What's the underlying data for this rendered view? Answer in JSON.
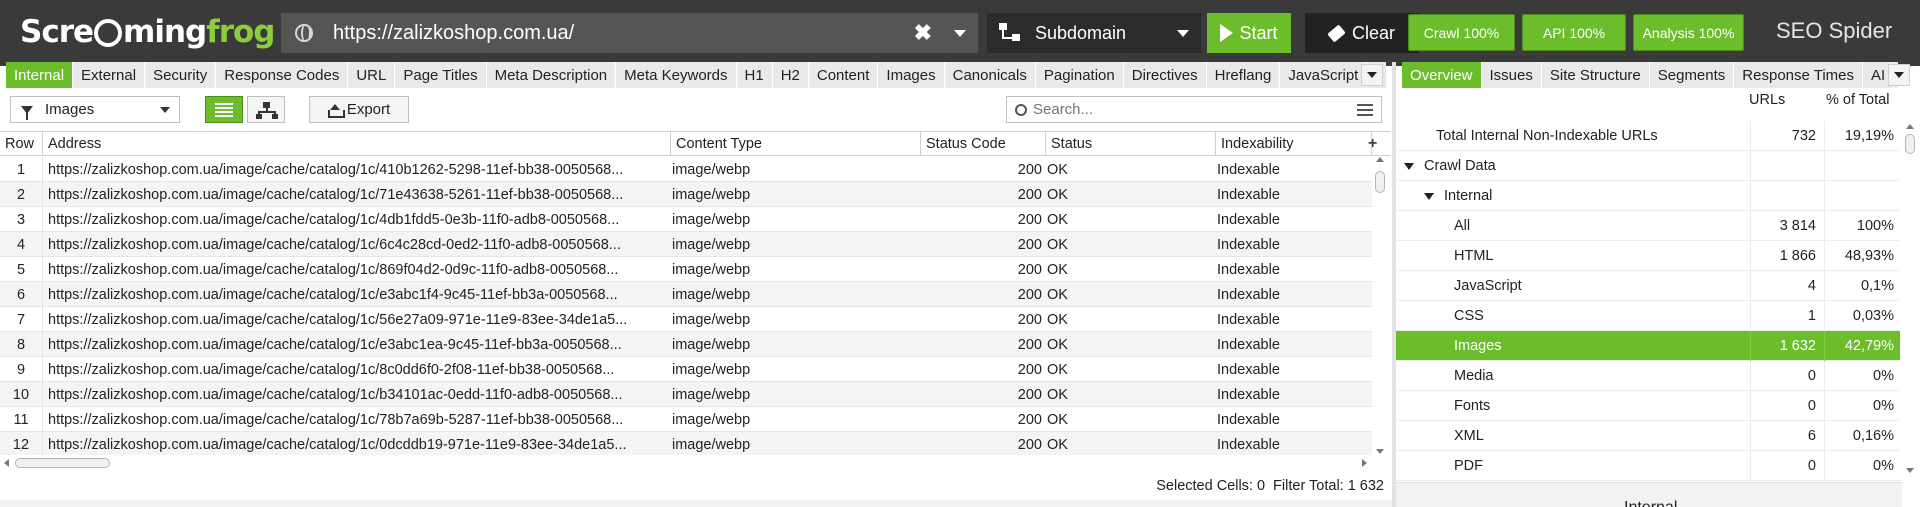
{
  "app": {
    "logo_part1": "Scre",
    "logo_part2": "ming",
    "logo_part3": "frog",
    "product": "SEO Spider"
  },
  "topbar": {
    "url": "https://zalizkoshop.com.ua/",
    "clear_glyph": "✖",
    "mode": "Subdomain",
    "start_label": "Start",
    "clear_label": "Clear",
    "crawl_progress": "Crawl 100%",
    "api_progress": "API 100%",
    "analysis_progress": "Analysis 100%"
  },
  "tabs_left": [
    {
      "label": "Internal",
      "active": true
    },
    {
      "label": "External"
    },
    {
      "label": "Security"
    },
    {
      "label": "Response Codes"
    },
    {
      "label": "URL"
    },
    {
      "label": "Page Titles"
    },
    {
      "label": "Meta Description"
    },
    {
      "label": "Meta Keywords"
    },
    {
      "label": "H1"
    },
    {
      "label": "H2"
    },
    {
      "label": "Content"
    },
    {
      "label": "Images"
    },
    {
      "label": "Canonicals"
    },
    {
      "label": "Pagination"
    },
    {
      "label": "Directives"
    },
    {
      "label": "Hreflang"
    },
    {
      "label": "JavaScript"
    }
  ],
  "tabs_right": [
    {
      "label": "Overview",
      "active": true
    },
    {
      "label": "Issues"
    },
    {
      "label": "Site Structure"
    },
    {
      "label": "Segments"
    },
    {
      "label": "Response Times"
    },
    {
      "label": "AI"
    }
  ],
  "toolbar": {
    "filter_value": "Images",
    "export_label": "Export",
    "search_placeholder": "Search..."
  },
  "table": {
    "columns": [
      "Row",
      "Address",
      "Content Type",
      "Status Code",
      "Status",
      "Indexability"
    ],
    "rows": [
      [
        "1",
        "https://zalizkoshop.com.ua/image/cache/catalog/1c/410b1262-5298-11ef-bb38-0050568...",
        "image/webp",
        "200",
        "OK",
        "Indexable"
      ],
      [
        "2",
        "https://zalizkoshop.com.ua/image/cache/catalog/1c/71e43638-5261-11ef-bb38-0050568...",
        "image/webp",
        "200",
        "OK",
        "Indexable"
      ],
      [
        "3",
        "https://zalizkoshop.com.ua/image/cache/catalog/1c/4db1fdd5-0e3b-11f0-adb8-0050568...",
        "image/webp",
        "200",
        "OK",
        "Indexable"
      ],
      [
        "4",
        "https://zalizkoshop.com.ua/image/cache/catalog/1c/6c4c28cd-0ed2-11f0-adb8-0050568...",
        "image/webp",
        "200",
        "OK",
        "Indexable"
      ],
      [
        "5",
        "https://zalizkoshop.com.ua/image/cache/catalog/1c/869f04d2-0d9c-11f0-adb8-0050568...",
        "image/webp",
        "200",
        "OK",
        "Indexable"
      ],
      [
        "6",
        "https://zalizkoshop.com.ua/image/cache/catalog/1c/e3abc1f4-9c45-11ef-bb3a-0050568...",
        "image/webp",
        "200",
        "OK",
        "Indexable"
      ],
      [
        "7",
        "https://zalizkoshop.com.ua/image/cache/catalog/1c/56e27a09-971e-11e9-83ee-34de1a5...",
        "image/webp",
        "200",
        "OK",
        "Indexable"
      ],
      [
        "8",
        "https://zalizkoshop.com.ua/image/cache/catalog/1c/e3abc1ea-9c45-11ef-bb3a-0050568...",
        "image/webp",
        "200",
        "OK",
        "Indexable"
      ],
      [
        "9",
        "https://zalizkoshop.com.ua/image/cache/catalog/1c/8c0dd6f0-2f08-11ef-bb38-0050568...",
        "image/webp",
        "200",
        "OK",
        "Indexable"
      ],
      [
        "10",
        "https://zalizkoshop.com.ua/image/cache/catalog/1c/b34101ac-0edd-11f0-adb8-0050568...",
        "image/webp",
        "200",
        "OK",
        "Indexable"
      ],
      [
        "11",
        "https://zalizkoshop.com.ua/image/cache/catalog/1c/78b7a69b-5287-11ef-bb38-0050568...",
        "image/webp",
        "200",
        "OK",
        "Indexable"
      ],
      [
        "12",
        "https://zalizkoshop.com.ua/image/cache/catalog/1c/0dcddb19-971e-11e9-83ee-34de1a5...",
        "image/webp",
        "200",
        "OK",
        "Indexable"
      ]
    ]
  },
  "status_bar": {
    "selected_label": "Selected Cells:",
    "selected_value": "0",
    "filter_label": "Filter Total:",
    "filter_value": "1 632"
  },
  "overview": {
    "col_urls": "URLs",
    "col_pct": "% of Total",
    "rows": [
      {
        "label": "Total Internal Non-Indexable URLs",
        "urls": "732",
        "pct": "19,19%",
        "level": 1
      },
      {
        "label": "Crawl Data",
        "urls": "",
        "pct": "",
        "level": 0,
        "expander": true
      },
      {
        "label": "Internal",
        "urls": "",
        "pct": "",
        "level": 1,
        "expander": true
      },
      {
        "label": "All",
        "urls": "3 814",
        "pct": "100%",
        "level": 2
      },
      {
        "label": "HTML",
        "urls": "1 866",
        "pct": "48,93%",
        "level": 2
      },
      {
        "label": "JavaScript",
        "urls": "4",
        "pct": "0,1%",
        "level": 2
      },
      {
        "label": "CSS",
        "urls": "1",
        "pct": "0,03%",
        "level": 2
      },
      {
        "label": "Images",
        "urls": "1 632",
        "pct": "42,79%",
        "level": 2,
        "selected": true
      },
      {
        "label": "Media",
        "urls": "0",
        "pct": "0%",
        "level": 2
      },
      {
        "label": "Fonts",
        "urls": "0",
        "pct": "0%",
        "level": 2
      },
      {
        "label": "XML",
        "urls": "6",
        "pct": "0,16%",
        "level": 2
      },
      {
        "label": "PDF",
        "urls": "0",
        "pct": "0%",
        "level": 2
      }
    ],
    "bottom_label": "Internal"
  },
  "colors": {
    "accent": "#6cbd2c",
    "topbar": "#3a3a3a"
  }
}
